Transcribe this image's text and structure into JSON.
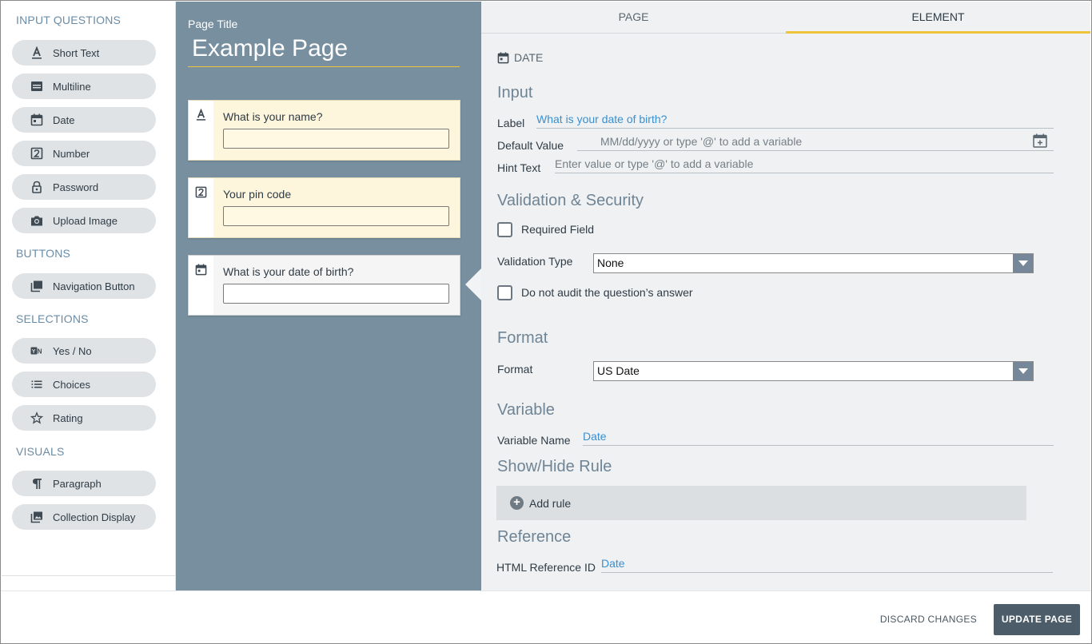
{
  "palette": {
    "sections": [
      {
        "title": "INPUT QUESTIONS"
      },
      {
        "title": "BUTTONS"
      },
      {
        "title": "SELECTIONS"
      },
      {
        "title": "VISUALS"
      }
    ],
    "items": [
      {
        "label": "Short Text",
        "icon": "text-a-icon"
      },
      {
        "label": "Multiline",
        "icon": "multiline-icon"
      },
      {
        "label": "Date",
        "icon": "calendar-icon"
      },
      {
        "label": "Number",
        "icon": "number-icon"
      },
      {
        "label": "Password",
        "icon": "lock-icon"
      },
      {
        "label": "Upload Image",
        "icon": "camera-icon"
      },
      {
        "label": "Navigation Button",
        "icon": "navigation-icon"
      },
      {
        "label": "Yes / No",
        "icon": "yes-no-icon"
      },
      {
        "label": "Choices",
        "icon": "list-icon"
      },
      {
        "label": "Rating",
        "icon": "star-icon"
      },
      {
        "label": "Paragraph",
        "icon": "paragraph-icon"
      },
      {
        "label": "Collection Display",
        "icon": "gallery-icon"
      }
    ]
  },
  "canvas": {
    "page_title_label": "Page Title",
    "page_title": "Example Page",
    "questions": [
      {
        "text": "What is your name?",
        "icon": "text-a-icon"
      },
      {
        "text": "Your pin code",
        "icon": "number-icon"
      },
      {
        "text": "What is your date of birth?",
        "icon": "calendar-icon"
      }
    ]
  },
  "panel": {
    "tabs": [
      "PAGE",
      "ELEMENT"
    ],
    "active_tab": "ELEMENT",
    "element_type": "DATE",
    "input": {
      "heading": "Input",
      "label_label": "Label",
      "label_value": "What is your date of birth?",
      "default_label": "Default Value",
      "default_placeholder": "MM/dd/yyyy or type '@' to add a variable",
      "hint_label": "Hint Text",
      "hint_placeholder": "Enter value or type '@' to add a variable"
    },
    "validation": {
      "heading": "Validation & Security",
      "required_label": "Required Field",
      "type_label": "Validation Type",
      "type_value": "None",
      "audit_label": "Do not audit the question’s answer"
    },
    "format": {
      "heading": "Format",
      "label": "Format",
      "value": "US Date"
    },
    "variable": {
      "heading": "Variable",
      "label": "Variable Name",
      "value": "Date"
    },
    "rule": {
      "heading": "Show/Hide Rule",
      "add_label": "Add rule"
    },
    "reference": {
      "heading": "Reference",
      "label": "HTML Reference ID",
      "value": "Date"
    }
  },
  "footer": {
    "discard_label": "DISCARD CHANGES",
    "update_label": "UPDATE PAGE"
  },
  "colors": {
    "accent": "#f0c43a",
    "canvas_bg": "#778f9f",
    "panel_bg": "#eff1f3",
    "link_blue": "#3a8fcf",
    "primary_button": "#4c5c69"
  }
}
